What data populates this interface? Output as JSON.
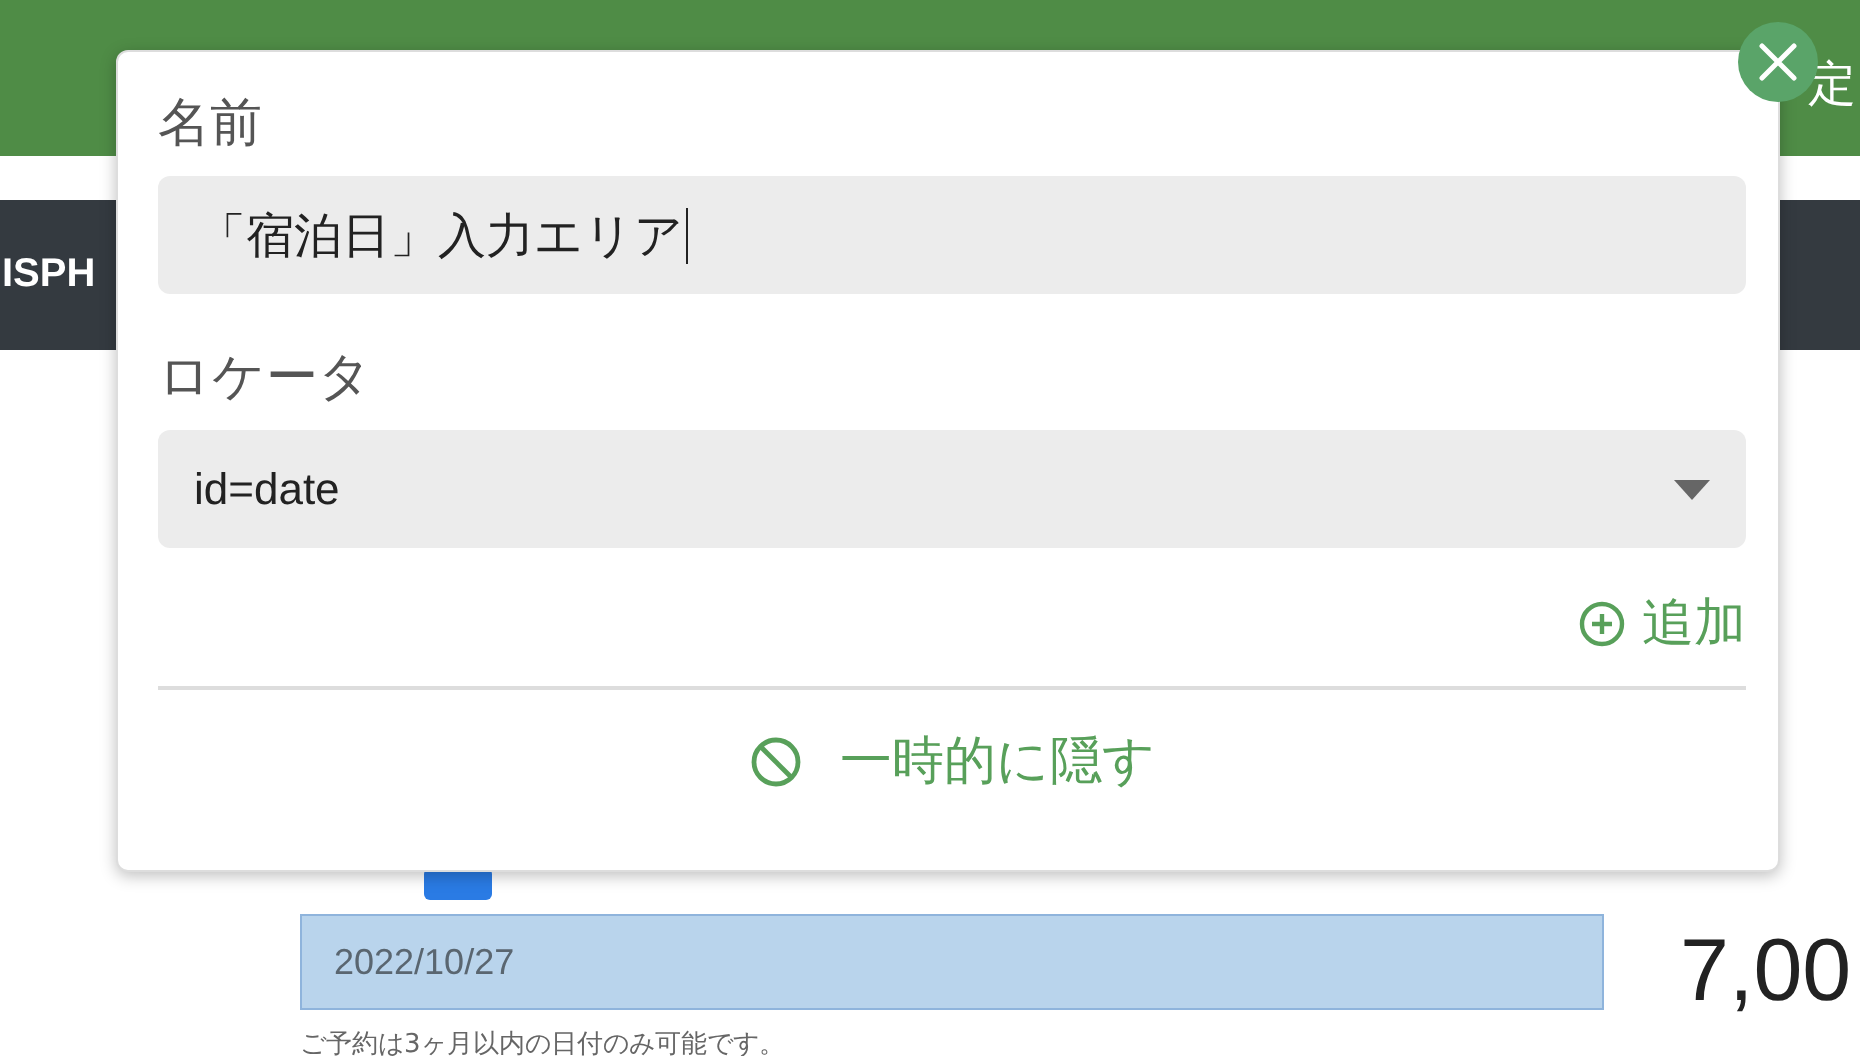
{
  "header": {
    "title_fragment": "定"
  },
  "navbar": {
    "brand_fragment": "ISPH"
  },
  "form": {
    "date_value": "2022/10/27",
    "help_text": "ご予約は3ヶ月以内の日付のみ可能です。",
    "total_value": "7,00"
  },
  "popup": {
    "name_label": "名前",
    "name_value": "「宿泊日」入力エリア",
    "locator_label": "ロケータ",
    "locator_value": "id=date",
    "add_link": "追加",
    "hide_button": "一時的に隠す"
  }
}
